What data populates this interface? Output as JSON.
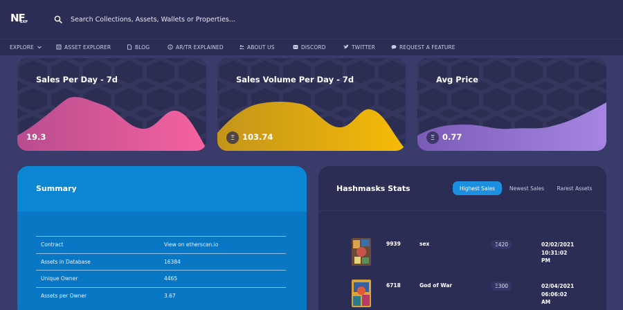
{
  "brand": {
    "logo_text": "NF",
    "logo_sub": "EXP"
  },
  "search": {
    "placeholder": "Search Collections, Assets, Wallets or Properties..."
  },
  "nav": [
    {
      "label": "EXPLORE",
      "icon": "compass-icon",
      "has_dropdown": true
    },
    {
      "label": "ASSET EXPLORER",
      "icon": "book-icon"
    },
    {
      "label": "BLOG",
      "icon": "document-icon"
    },
    {
      "label": "AR/TR EXPLAINED",
      "icon": "info-icon"
    },
    {
      "label": "ABOUT US",
      "icon": "people-icon"
    },
    {
      "label": "DISCORD",
      "icon": "discord-icon"
    },
    {
      "label": "TWITTER",
      "icon": "twitter-icon"
    },
    {
      "label": "REQUEST A FEATURE",
      "icon": "chat-icon"
    }
  ],
  "cards": [
    {
      "title": "Sales Per Day - 7d",
      "value": "19.3",
      "currency_icon": false,
      "colors": [
        "#c04f92",
        "#f5609f"
      ]
    },
    {
      "title": "Sales Volume Per Day - 7d",
      "value": "103.74",
      "currency_icon": true,
      "currency_symbol": "Ξ",
      "colors": [
        "#c89615",
        "#f5b90a"
      ]
    },
    {
      "title": "Avg Price",
      "value": "0.77",
      "currency_icon": true,
      "currency_symbol": "Ξ",
      "colors": [
        "#7c5fb8",
        "#a484e0"
      ]
    }
  ],
  "summary": {
    "title": "Summary",
    "rows": [
      {
        "label": "Contract",
        "value": "View on etherscan.io"
      },
      {
        "label": "Assets in Database",
        "value": "16384"
      },
      {
        "label": "Unique Owner",
        "value": "4465"
      },
      {
        "label": "Assets per Owner",
        "value": "3.67"
      }
    ]
  },
  "stats": {
    "title": "Hashmasks Stats",
    "tabs": [
      {
        "label": "Highest Sales",
        "active": true
      },
      {
        "label": "Newest Sales",
        "active": false
      },
      {
        "label": "Rarest Assets",
        "active": false
      }
    ],
    "sales": [
      {
        "id": "9939",
        "name": "sex",
        "price": "Ξ420",
        "date_lines": [
          "02/02/2021",
          "10:31:02",
          "PM"
        ]
      },
      {
        "id": "6718",
        "name": "God of War",
        "price": "Ξ300",
        "date_lines": [
          "02/04/2021",
          "06:06:02",
          "AM"
        ]
      }
    ]
  },
  "colors": {
    "background": "#393b6b",
    "panel": "#2c2d54",
    "summary_blue": "#0a7fcf",
    "accent": "#1d8fe0"
  }
}
